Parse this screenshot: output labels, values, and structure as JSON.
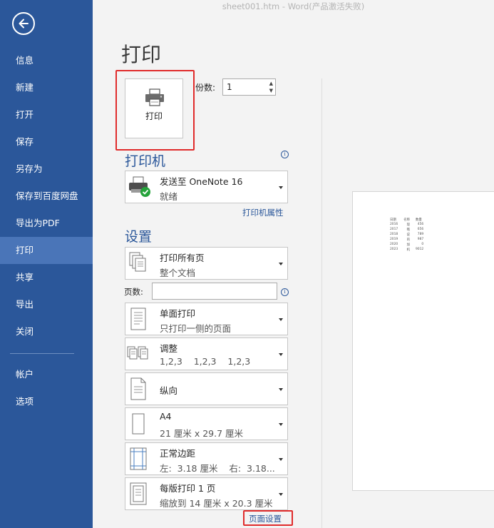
{
  "window_title": "sheet001.htm - Word(产品激活失败)",
  "sidebar": {
    "items": [
      {
        "label": "信息",
        "active": false
      },
      {
        "label": "新建",
        "active": false
      },
      {
        "label": "打开",
        "active": false
      },
      {
        "label": "保存",
        "active": false
      },
      {
        "label": "另存为",
        "active": false
      },
      {
        "label": "保存到百度网盘",
        "active": false
      },
      {
        "label": "导出为PDF",
        "active": false
      },
      {
        "label": "打印",
        "active": true
      },
      {
        "label": "共享",
        "active": false
      },
      {
        "label": "导出",
        "active": false
      },
      {
        "label": "关闭",
        "active": false
      }
    ],
    "bottom_items": [
      {
        "label": "帐户"
      },
      {
        "label": "选项"
      }
    ]
  },
  "print": {
    "heading": "打印",
    "button_label": "打印",
    "copies_label": "份数:",
    "copies_value": "1"
  },
  "printer": {
    "section_title": "打印机",
    "name": "发送至 OneNote 16",
    "status": "就绪",
    "properties_link": "打印机属性"
  },
  "settings": {
    "section_title": "设置",
    "pages_label": "页数:",
    "pages_value": "",
    "page_setup_link": "页面设置",
    "options": [
      {
        "title": "打印所有页",
        "subtitle": "整个文档",
        "icon": "pages-icon"
      },
      {
        "title": "单面打印",
        "subtitle": "只打印一侧的页面",
        "icon": "one-sided-icon"
      },
      {
        "title": "调整",
        "subtitle": "1,2,3    1,2,3    1,2,3",
        "icon": "collate-icon"
      },
      {
        "title": "纵向",
        "subtitle": "",
        "icon": "portrait-icon"
      },
      {
        "title": "A4",
        "subtitle": "21 厘米 x 29.7 厘米",
        "icon": "paper-size-icon"
      },
      {
        "title": "正常边距",
        "subtitle": "左:  3.18 厘米    右:  3.18...",
        "icon": "margins-icon"
      },
      {
        "title": "每版打印 1 页",
        "subtitle": "缩放到 14 厘米 x 20.3 厘米",
        "icon": "pages-per-sheet-icon"
      }
    ]
  },
  "preview": {
    "headers": [
      "日期",
      "名称",
      "数量"
    ],
    "rows": [
      [
        "2016",
        "现",
        "456"
      ],
      [
        "2017",
        "哦",
        "656"
      ],
      [
        "2018",
        "说",
        "789"
      ],
      [
        "2019",
        "的",
        "987"
      ],
      [
        "2020",
        "加",
        "0"
      ],
      [
        "2023",
        "机",
        "9012"
      ]
    ]
  },
  "colors": {
    "sidebar_bg": "#2b579a",
    "sidebar_active": "#4a75b8",
    "accent": "#2b579a",
    "highlight_box": "#e02b2b"
  }
}
